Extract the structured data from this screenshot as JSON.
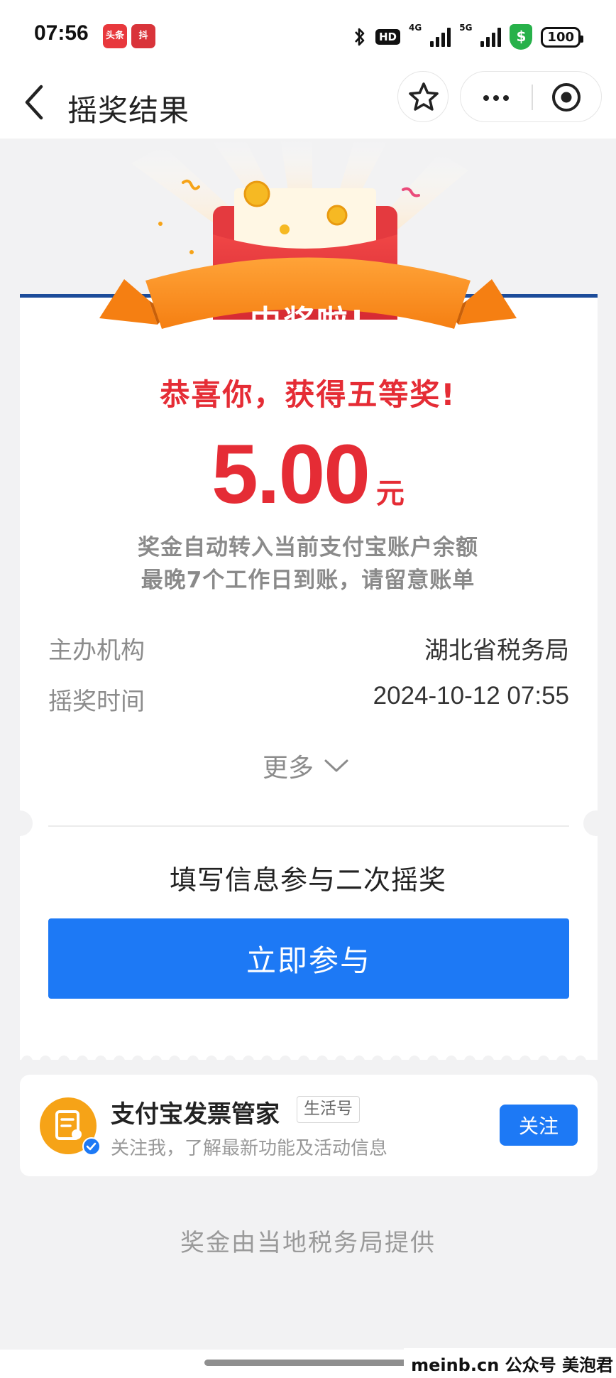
{
  "status_bar": {
    "time": "07:56",
    "app_badge_1": "头条",
    "app_badge_2": "抖",
    "hd": "HD",
    "net1": "4G",
    "net2": "5G",
    "battery": "100"
  },
  "nav": {
    "title": "摇奖结果"
  },
  "banner": {
    "ribbon_text": "中奖啦!"
  },
  "prize": {
    "congrats": "恭喜你，获得五等奖!",
    "amount": "5.00",
    "unit": "元",
    "note_line1": "奖金自动转入当前支付宝账户余额",
    "note_line2": "最晚7个工作日到账，请留意账单",
    "info": [
      {
        "label": "主办机构",
        "value": "湖北省税务局"
      },
      {
        "label": "摇奖时间",
        "value": "2024-10-12 07:55"
      }
    ],
    "more_label": "更多"
  },
  "second_draw": {
    "title": "填写信息参与二次摇奖",
    "button_label": "立即参与"
  },
  "account": {
    "name": "支付宝发票管家",
    "tag": "生活号",
    "description": "关注我，了解最新功能及活动信息",
    "follow_label": "关注"
  },
  "footer": {
    "note": "奖金由当地税务局提供"
  },
  "watermark": "meinb.cn  公众号 美泡君",
  "colors": {
    "prize_red": "#e52c35",
    "primary_blue": "#1d79f5",
    "ribbon_orange": "#f99221",
    "page_bg": "#f2f2f3"
  }
}
